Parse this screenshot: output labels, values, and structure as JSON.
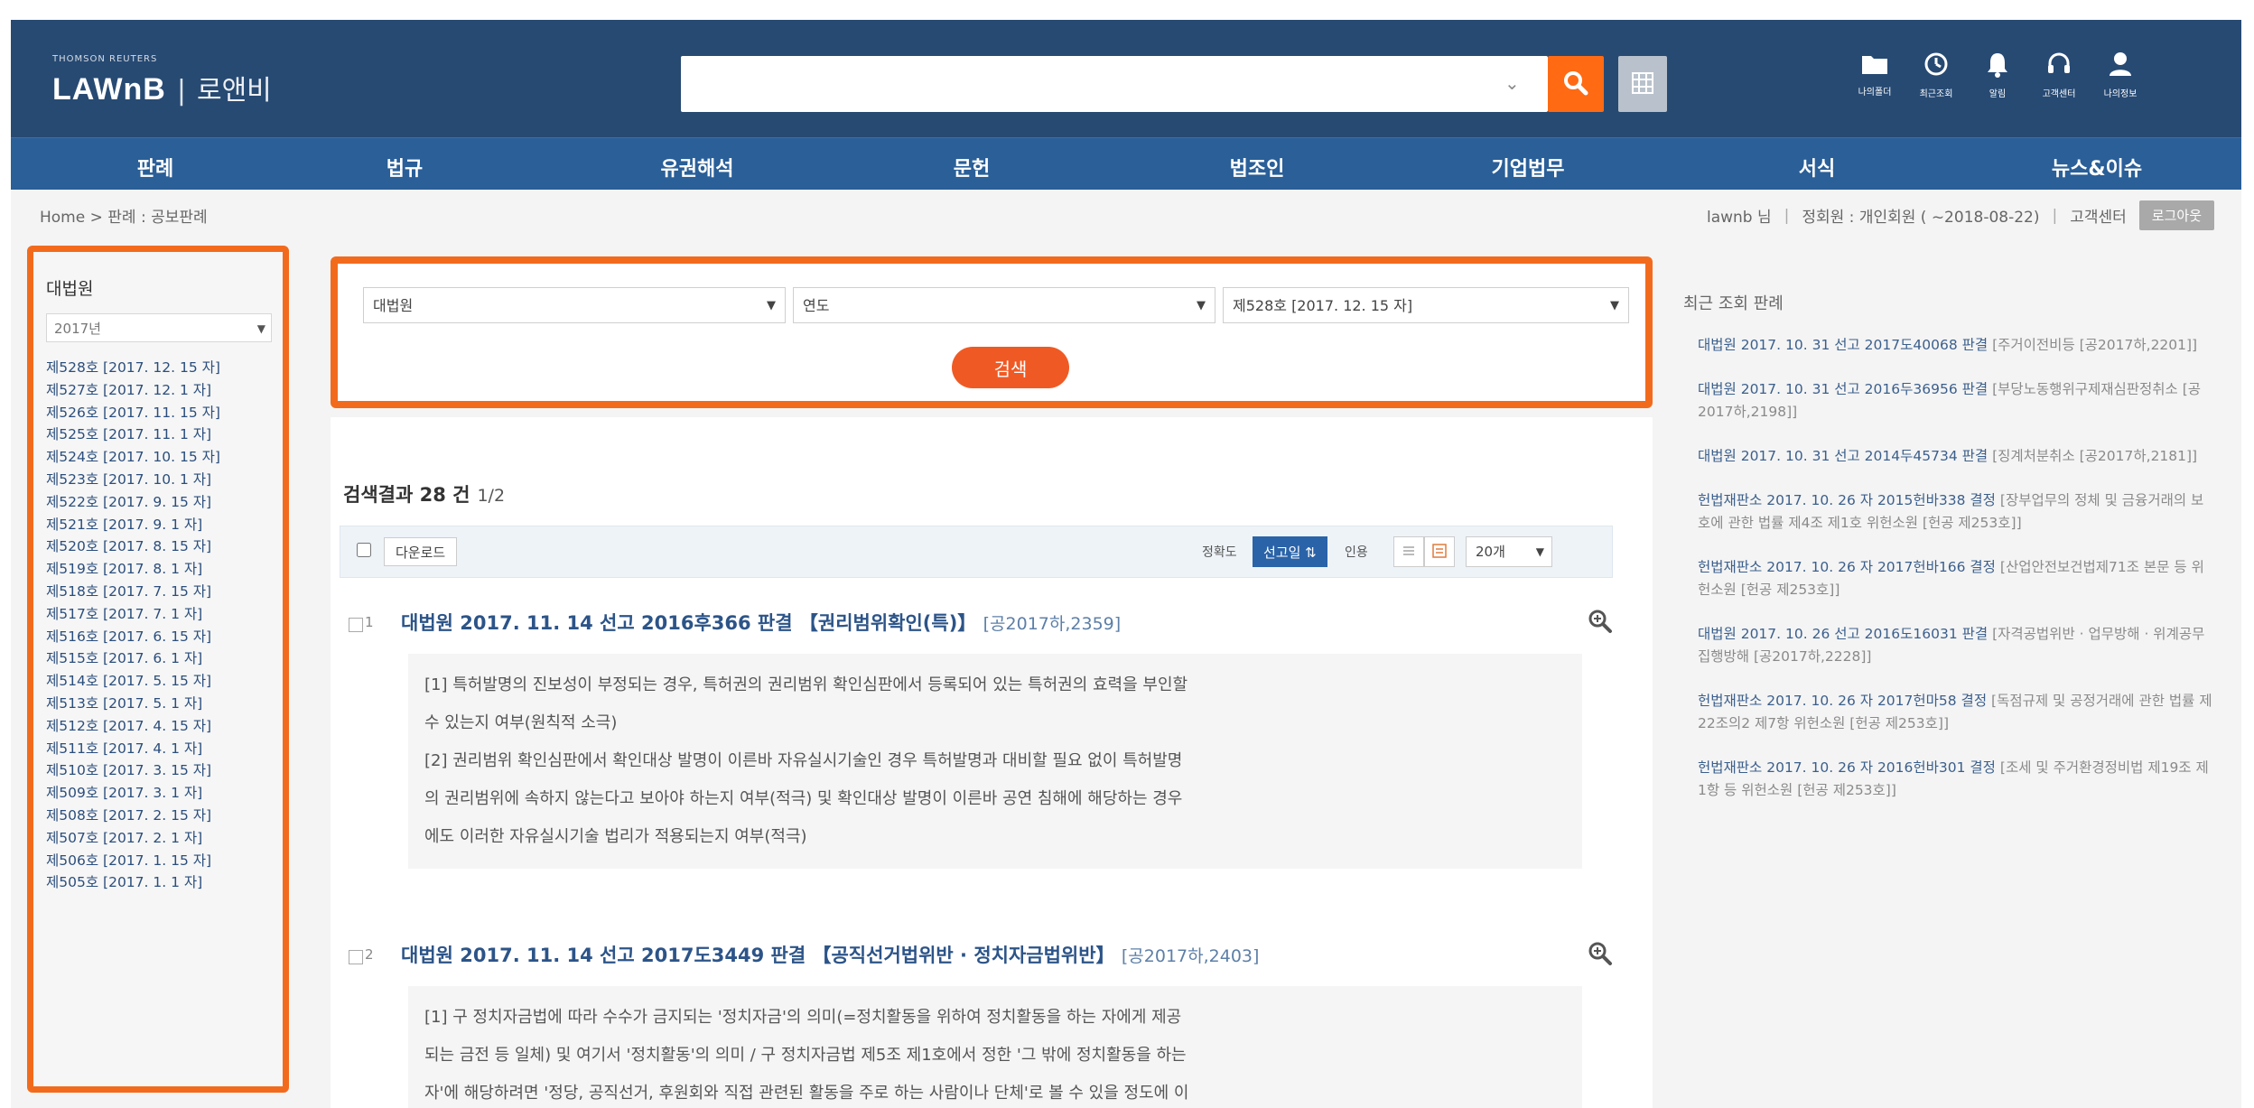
{
  "header": {
    "brand_small": "THOMSON REUTERS",
    "brand": "LAWnB",
    "brand_sep": "|",
    "brand_kor": "로앤비",
    "search": {
      "placeholder": "",
      "value": ""
    },
    "icons": [
      {
        "name": "folder-icon",
        "label": "나의폴더"
      },
      {
        "name": "clock-icon",
        "label": "최근조회"
      },
      {
        "name": "bell-icon",
        "label": "알림"
      },
      {
        "name": "headset-icon",
        "label": "고객센터"
      },
      {
        "name": "user-icon",
        "label": "나의정보"
      }
    ]
  },
  "nav": {
    "items": [
      "판례",
      "법규",
      "유권해석",
      "문헌",
      "법조인",
      "기업법무",
      "서식",
      "뉴스&이슈"
    ]
  },
  "utility": {
    "breadcrumb": "Home > 판례 : 공보판례",
    "user": "lawnb 님",
    "member": "정회원 : 개인회원 ( ~2018-08-22)",
    "customer_center": "고객센터",
    "logout": "로그아웃"
  },
  "left_panel": {
    "title": "대법원",
    "year_select": "2017년",
    "issues": [
      "제528호 [2017. 12. 15 자]",
      "제527호 [2017. 12. 1 자]",
      "제526호 [2017. 11. 15 자]",
      "제525호 [2017. 11. 1 자]",
      "제524호 [2017. 10. 15 자]",
      "제523호 [2017. 10. 1 자]",
      "제522호 [2017. 9. 15 자]",
      "제521호 [2017. 9. 1 자]",
      "제520호 [2017. 8. 15 자]",
      "제519호 [2017. 8. 1 자]",
      "제518호 [2017. 7. 15 자]",
      "제517호 [2017. 7. 1 자]",
      "제516호 [2017. 6. 15 자]",
      "제515호 [2017. 6. 1 자]",
      "제514호 [2017. 5. 15 자]",
      "제513호 [2017. 5. 1 자]",
      "제512호 [2017. 4. 15 자]",
      "제511호 [2017. 4. 1 자]",
      "제510호 [2017. 3. 15 자]",
      "제509호 [2017. 3. 1 자]",
      "제508호 [2017. 2. 15 자]",
      "제507호 [2017. 2. 1 자]",
      "제506호 [2017. 1. 15 자]",
      "제505호 [2017. 1. 1 자]"
    ]
  },
  "filter": {
    "court": "대법원",
    "year": "연도",
    "issue": "제528호 [2017. 12. 15 자]",
    "submit": "검색"
  },
  "results": {
    "count_label": "검색결과 28 건",
    "page": "1/2",
    "download": "다운로드",
    "sort_label": "정확도",
    "sort_active": "선고일 ⇅",
    "sort_other": "인용",
    "per_page": "20개",
    "items": [
      {
        "num": "1",
        "title": "대법원 2017. 11. 14 선고 2016후366 판결 【권리범위확인(특)】",
        "source": "[공2017하,2359]",
        "summary": [
          "[1] 특허발명의 진보성이 부정되는 경우, 특허권의 권리범위 확인심판에서 등록되어 있는 특허권의 효력을 부인할",
          "수 있는지 여부(원칙적 소극)",
          "[2] 권리범위 확인심판에서 확인대상 발명이 이른바 자유실시기술인 경우 특허발명과 대비할 필요 없이 특허발명",
          "의 권리범위에 속하지 않는다고 보아야 하는지 여부(적극) 및 확인대상 발명이 이른바 공연 침해에 해당하는 경우",
          "에도 이러한 자유실시기술 법리가 적용되는지 여부(적극)"
        ]
      },
      {
        "num": "2",
        "title": "대법원 2017. 11. 14 선고 2017도3449 판결 【공직선거법위반 · 정치자금법위반】",
        "source": "[공2017하,2403]",
        "summary": [
          "[1] 구 정치자금법에 따라 수수가 금지되는 '정치자금'의 의미(=정치활동을 위하여 정치활동을 하는 자에게 제공",
          "되는 금전 등 일체) 및 여기서 '정치활동'의 의미 / 구 정치자금법 제5조 제1호에서 정한 '그 밖에 정치활동을 하는",
          "자'에 해당하려면 '정당, 공직선거, 후원회와 직접 관련된 활동을 주로 하는 사람이나 단체'로 볼 수 있을 정도에 이"
        ]
      }
    ]
  },
  "recent": {
    "title": "최근 조회 판례",
    "items": [
      {
        "t": "대법원 2017. 10. 31 선고 2017도40068 판결",
        "d": "[주거이전비등 [공2017하,2201]]"
      },
      {
        "t": "대법원 2017. 10. 31 선고 2016두36956 판결",
        "d": "[부당노동행위구제재심판정취소 [공2017하,2198]]"
      },
      {
        "t": "대법원 2017. 10. 31 선고 2014두45734 판결",
        "d": "[징계처분취소 [공2017하,2181]]"
      },
      {
        "t": "헌법재판소 2017. 10. 26 자 2015헌바338 결정",
        "d": "[장부업무의 정체 및 금융거래의 보호에 관한 법률 제4조 제1호 위헌소원 [헌공 제253호]]"
      },
      {
        "t": "헌법재판소 2017. 10. 26 자 2017헌바166 결정",
        "d": "[산업안전보건법제71조 본문 등 위헌소원 [헌공 제253호]]"
      },
      {
        "t": "대법원 2017. 10. 26 선고 2016도16031 판결",
        "d": "[자격공법위반 · 업무방해 · 위계공무집행방해 [공2017하,2228]]"
      },
      {
        "t": "헌법재판소 2017. 10. 26 자 2017헌마58 결정",
        "d": "[독점규제 및 공정거래에 관한 법률 제22조의2 제7항 위헌소원 [헌공 제253호]]"
      },
      {
        "t": "헌법재판소 2017. 10. 26 자 2016헌바301 결정",
        "d": "[조세 및 주거환경정비법 제19조 제1항 등 위헌소원 [헌공 제253호]]"
      }
    ]
  },
  "colors": {
    "header_bg": "#274a73",
    "nav_bg": "#2a5f98",
    "accent_orange": "#f26b1d",
    "link_blue": "#2c5488"
  }
}
